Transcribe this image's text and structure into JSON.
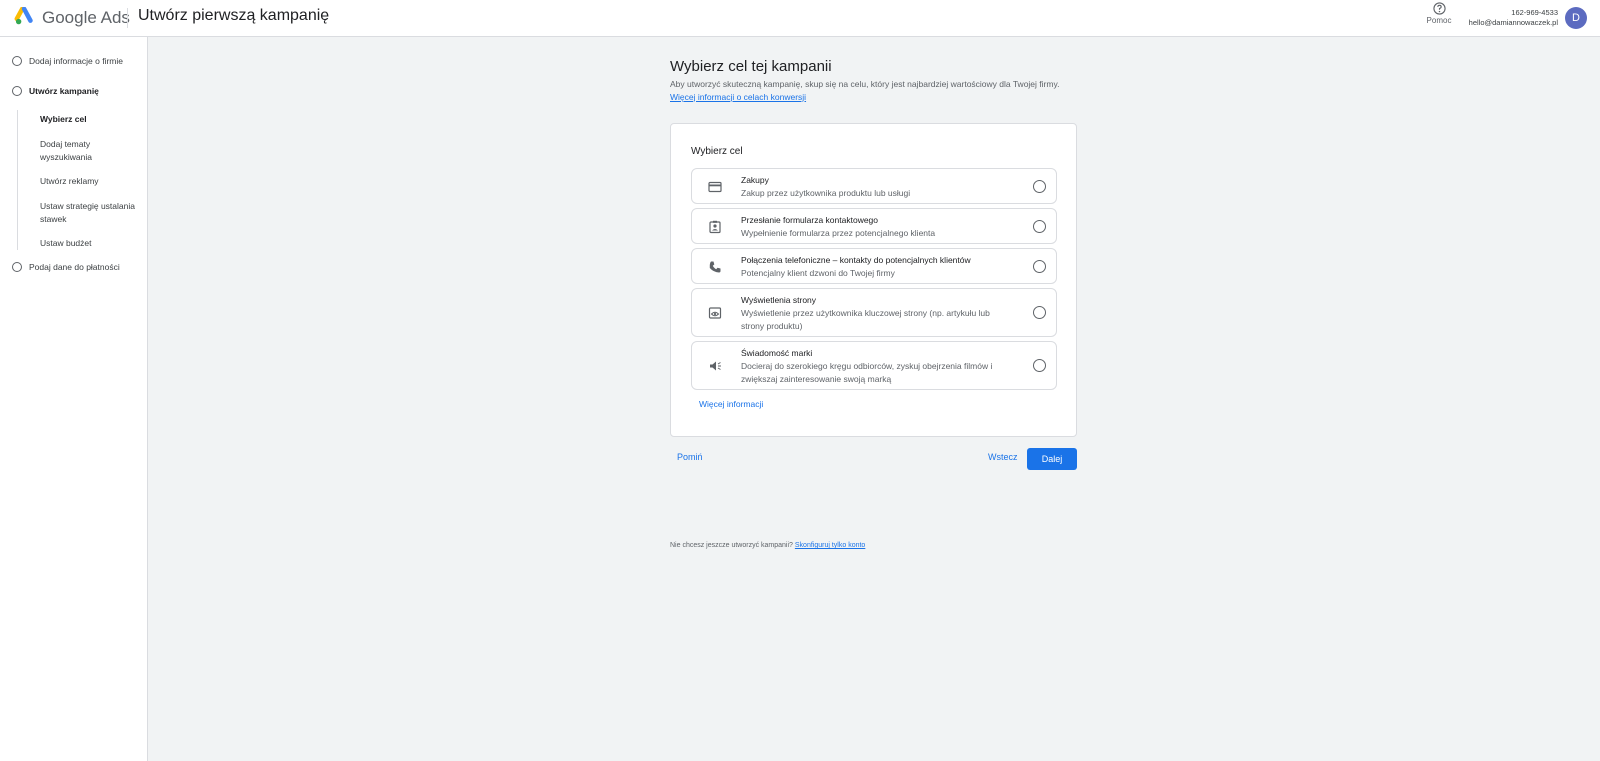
{
  "header": {
    "brand": "Google Ads",
    "title": "Utwórz pierwszą kampanię",
    "help_label": "Pomoc",
    "phone": "162-969-4533",
    "email": "hello@damiannowaczek.pl",
    "avatar_letter": "D"
  },
  "sidebar": {
    "steps": [
      {
        "label": "Dodaj informacje o firmie"
      },
      {
        "label": "Utwórz kampanię"
      },
      {
        "label": "Podaj dane do płatności"
      }
    ],
    "substeps": [
      {
        "label": "Wybierz cel"
      },
      {
        "label": "Dodaj tematy wyszukiwania"
      },
      {
        "label": "Utwórz reklamy"
      },
      {
        "label": "Ustaw strategię ustalania stawek"
      },
      {
        "label": "Ustaw budżet"
      }
    ]
  },
  "main": {
    "title": "Wybierz cel tej kampanii",
    "description": "Aby utworzyć skuteczną kampanię, skup się na celu, który jest najbardziej wartościowy dla Twojej firmy.",
    "description_link": "Więcej informacji o celach konwersji",
    "card_title": "Wybierz cel",
    "options": [
      {
        "title": "Zakupy",
        "desc": "Zakup przez użytkownika produktu lub usługi",
        "icon": "credit-card-icon"
      },
      {
        "title": "Przesłanie formularza kontaktowego",
        "desc": "Wypełnienie formularza przez potencjalnego klienta",
        "icon": "contact-form-icon"
      },
      {
        "title": "Połączenia telefoniczne – kontakty do potencjalnych klientów",
        "desc": "Potencjalny klient dzwoni do Twojej firmy",
        "icon": "phone-icon"
      },
      {
        "title": "Wyświetlenia strony",
        "desc": "Wyświetlenie przez użytkownika kluczowej strony (np. artykułu lub strony produktu)",
        "icon": "page-view-icon"
      },
      {
        "title": "Świadomość marki",
        "desc": "Docieraj do szerokiego kręgu odbiorców, zyskuj obejrzenia filmów i zwiększaj zainteresowanie swoją marką",
        "icon": "megaphone-icon"
      }
    ],
    "more_info": "Więcej informacji",
    "skip": "Pomiń",
    "back": "Wstecz",
    "next": "Dalej",
    "footer_text": "Nie chcesz jeszcze utworzyć kampanii?",
    "footer_link": "Skonfiguruj tylko konto"
  },
  "colors": {
    "accent": "#1a73e8",
    "background": "#f1f3f4",
    "avatar": "#5c6bc0"
  }
}
